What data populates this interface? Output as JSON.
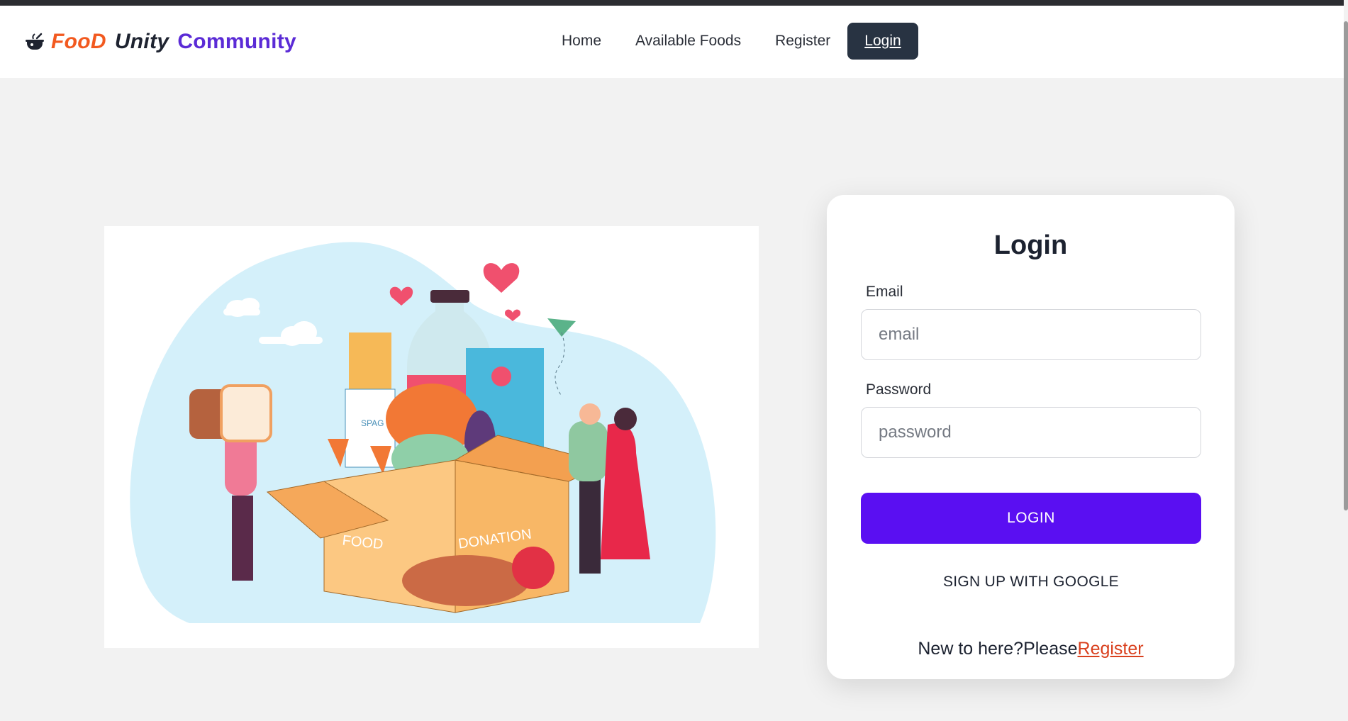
{
  "brand": {
    "part1": "FooD",
    "part2": "Unity",
    "part3": "Community",
    "icon": "cooking-pot-icon"
  },
  "nav": {
    "items": [
      "Home",
      "Available Foods",
      "Register",
      "Login"
    ],
    "active": "Login"
  },
  "illustration": {
    "box_label_left": "FOOD",
    "box_label_right": "DONATION",
    "pasta_label": "SPAG"
  },
  "login_form": {
    "title": "Login",
    "email_label": "Email",
    "email_placeholder": "email",
    "password_label": "Password",
    "password_placeholder": "password",
    "submit_label": "LOGIN",
    "google_label": "SIGN UP WITH GOOGLE",
    "signup_prompt": "New to here?Please",
    "signup_link": "Register"
  },
  "colors": {
    "primary": "#5a0ff2",
    "brand_orange": "#f2591f",
    "brand_purple": "#5b2bd6",
    "nav_active": "#283342",
    "link": "#d9401e"
  }
}
